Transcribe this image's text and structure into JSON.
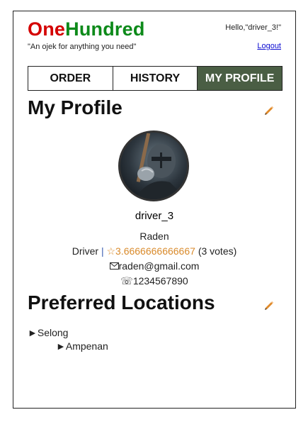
{
  "header": {
    "logo_one": "One",
    "logo_hundred": "Hundred",
    "tagline": "\"An ojek for anything you need\"",
    "greeting": "Hello,\"driver_3!\"",
    "logout_label": "Logout"
  },
  "nav": {
    "tabs": [
      {
        "label": "ORDER",
        "active": false
      },
      {
        "label": "HISTORY",
        "active": false
      },
      {
        "label": "MY PROFILE",
        "active": true
      }
    ]
  },
  "profile": {
    "title": "My Profile",
    "username": "driver_3",
    "name": "Raden",
    "role": "Driver",
    "separator": "|",
    "rating": "☆3.6666666666667",
    "votes": "(3 votes)",
    "email": "raden@gmail.com",
    "phone": "1234567890"
  },
  "locations": {
    "title": "Preferred Locations",
    "items": [
      "Selong",
      "Ampenan"
    ]
  },
  "colors": {
    "logo_one": "#d40000",
    "logo_hundred": "#0d8a1a",
    "active_tab": "#4a5e44",
    "rating": "#d98a2b",
    "edit_icon": "#e08a2a"
  },
  "icons": {
    "edit": "pencil-icon",
    "email": "envelope-icon",
    "phone": "telephone-icon",
    "bullet": "triangle-right-icon"
  }
}
